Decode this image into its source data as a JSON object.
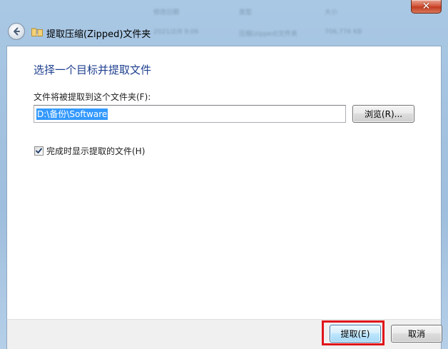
{
  "window": {
    "close_symbol": "✕",
    "background_fragments": [
      "修改日期",
      "类型",
      "大小",
      "2021/2/8 9:06",
      "压缩(zipped)文件夹",
      "706,776 KB"
    ]
  },
  "nav": {
    "title": "提取压缩(Zipped)文件夹",
    "back_icon": "back-arrow-icon",
    "folder_icon": "zip-folder-icon"
  },
  "main": {
    "heading": "选择一个目标并提取文件",
    "destination_label": "文件将被提取到这个文件夹(F):",
    "destination_value": "D:\\备份\\Software",
    "browse_label": "浏览(R)...",
    "show_files_label": "完成时显示提取的文件(H)",
    "show_files_checked": true
  },
  "footer": {
    "extract_label": "提取(E)",
    "cancel_label": "取消"
  },
  "colors": {
    "heading": "#1e3f8f",
    "selection": "#3399ff",
    "highlight": "#e0151b",
    "frame": "#a9c8e4"
  }
}
